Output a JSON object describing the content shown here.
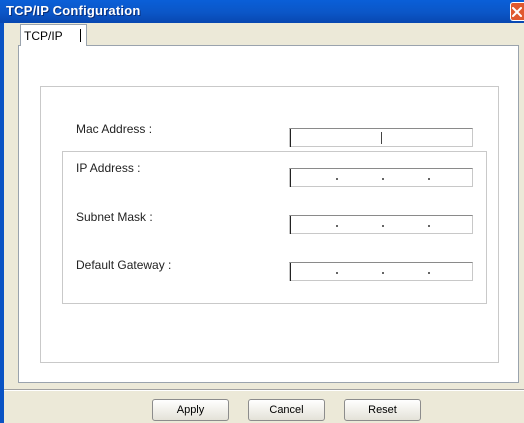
{
  "window": {
    "title": "TCP/IP Configuration"
  },
  "tabs": [
    {
      "label": "TCP/IP",
      "active": true
    }
  ],
  "form": {
    "mac_address_label": "Mac Address :",
    "mac_address_value": "",
    "ip_address_label": "IP Address :",
    "ip_address_value": ". . .",
    "subnet_mask_label": "Subnet Mask :",
    "subnet_mask_value": ". . .",
    "default_gateway_label": "Default Gateway :",
    "default_gateway_value": ". . ."
  },
  "buttons": {
    "apply": "Apply",
    "cancel": "Cancel",
    "reset": "Reset"
  },
  "icons": {
    "close": "close-icon"
  },
  "colors": {
    "titlebar": "#0b56c7",
    "close_button": "#e0592f",
    "dialog_background": "#ece9d8"
  }
}
